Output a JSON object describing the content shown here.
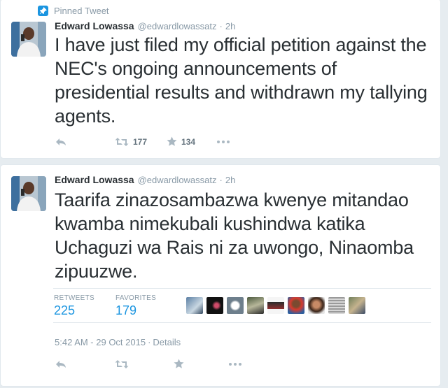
{
  "pinned_label": "Pinned Tweet",
  "tweet1": {
    "name": "Edward Lowassa",
    "handle": "@edwardlowassatz",
    "time": "2h",
    "text": "I have just filed my official petition against the NEC's ongoing announcements of presidential results and withdrawn my tallying agents.",
    "retweets": "177",
    "favorites": "134"
  },
  "tweet2": {
    "name": "Edward Lowassa",
    "handle": "@edwardlowassatz",
    "time": "2h",
    "text": "Taarifa zinazosambazwa kwenye mitandao kwamba nimekubali kushindwa katika Uchaguzi wa Rais ni za uwongo, Ninaomba zipuuzwe.",
    "retweets_label": "RETWEETS",
    "retweets": "225",
    "favorites_label": "FAVORITES",
    "favorites": "179",
    "timestamp": "5:42 AM - 29 Oct 2015",
    "details_label": "Details"
  },
  "icons": [
    "pin-icon",
    "reply-icon",
    "retweet-icon",
    "favorite-icon",
    "more-icon"
  ],
  "colors": {
    "background": "#e6ecf0",
    "link": "#1b95e0",
    "muted": "#8899a6",
    "text": "#292f33"
  }
}
